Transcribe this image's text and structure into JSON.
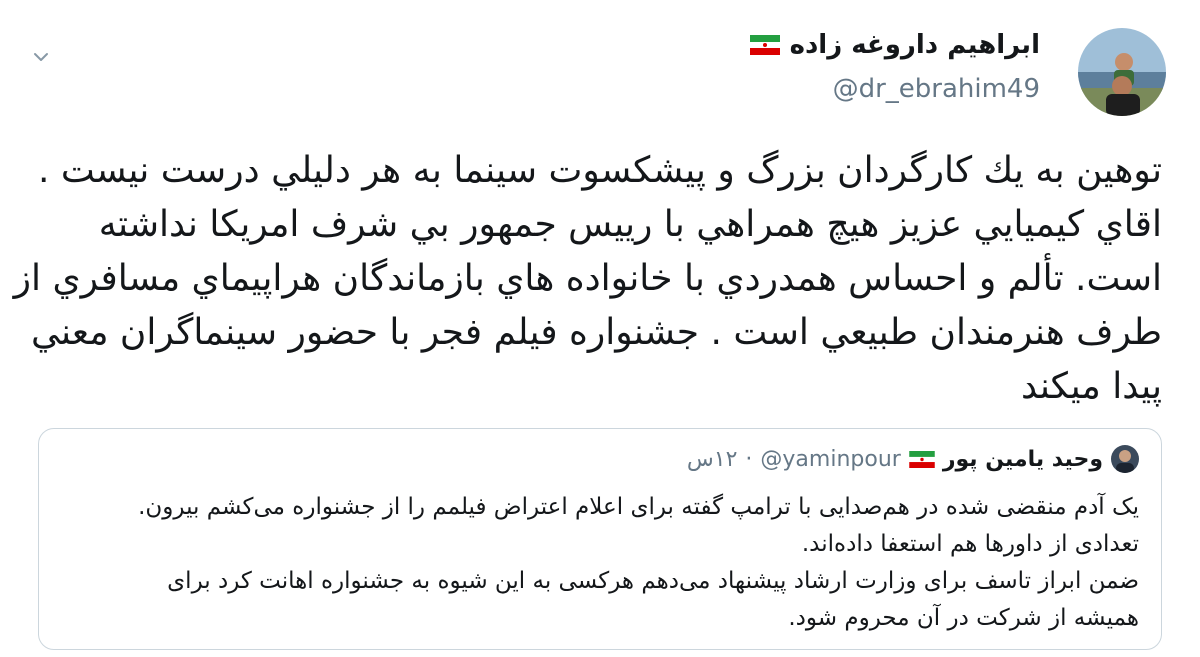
{
  "tweet": {
    "author_name": "ابراهیم داروغه زاده",
    "author_handle": "@dr_ebrahim49",
    "text_lines": [
      "توهين به يك كارگردان بزرگ و پيشكسوت سينما به هر دليلي درست نيست .",
      "اقاي كيميايي عزيز هيچ همراهي با رييس جمهور بي شرف امريكا نداشته",
      "است. تألم و احساس همدردي با خانواده هاي بازماندگان هراپيماي مسافري از",
      "طرف هنرمندان طبيعي است . جشنواره فيلم فجر با حضور سينماگران معني",
      "پيدا ميكند"
    ],
    "icons": {
      "caret": "chevron-down-icon",
      "avatar": "avatar-photo",
      "flag": "iran-flag-icon"
    }
  },
  "quoted": {
    "author_name": "وحید یامین پور",
    "author_handle": "@yaminpour",
    "separator": "·",
    "time": "۱۲س",
    "text_lines": [
      "یک آدم منقضی شده در هم‌صدایی با ترامپ گفته برای اعلام اعتراض فیلمم را از جشنواره می‌کشم بیرون.",
      "تعدادی از داورها هم استعفا داده‌اند.",
      "ضمن ابراز تاسف برای وزارت ارشاد پیشنهاد می‌دهم هرکسی به این شیوه به جشنواره اهانت کرد برای",
      "همیشه از شرکت در آن محروم شود."
    ]
  },
  "colors": {
    "text": "#14171a",
    "secondary": "#657786",
    "border": "#ccd6dd",
    "flag_green": "#239f40",
    "flag_red": "#da0000"
  }
}
